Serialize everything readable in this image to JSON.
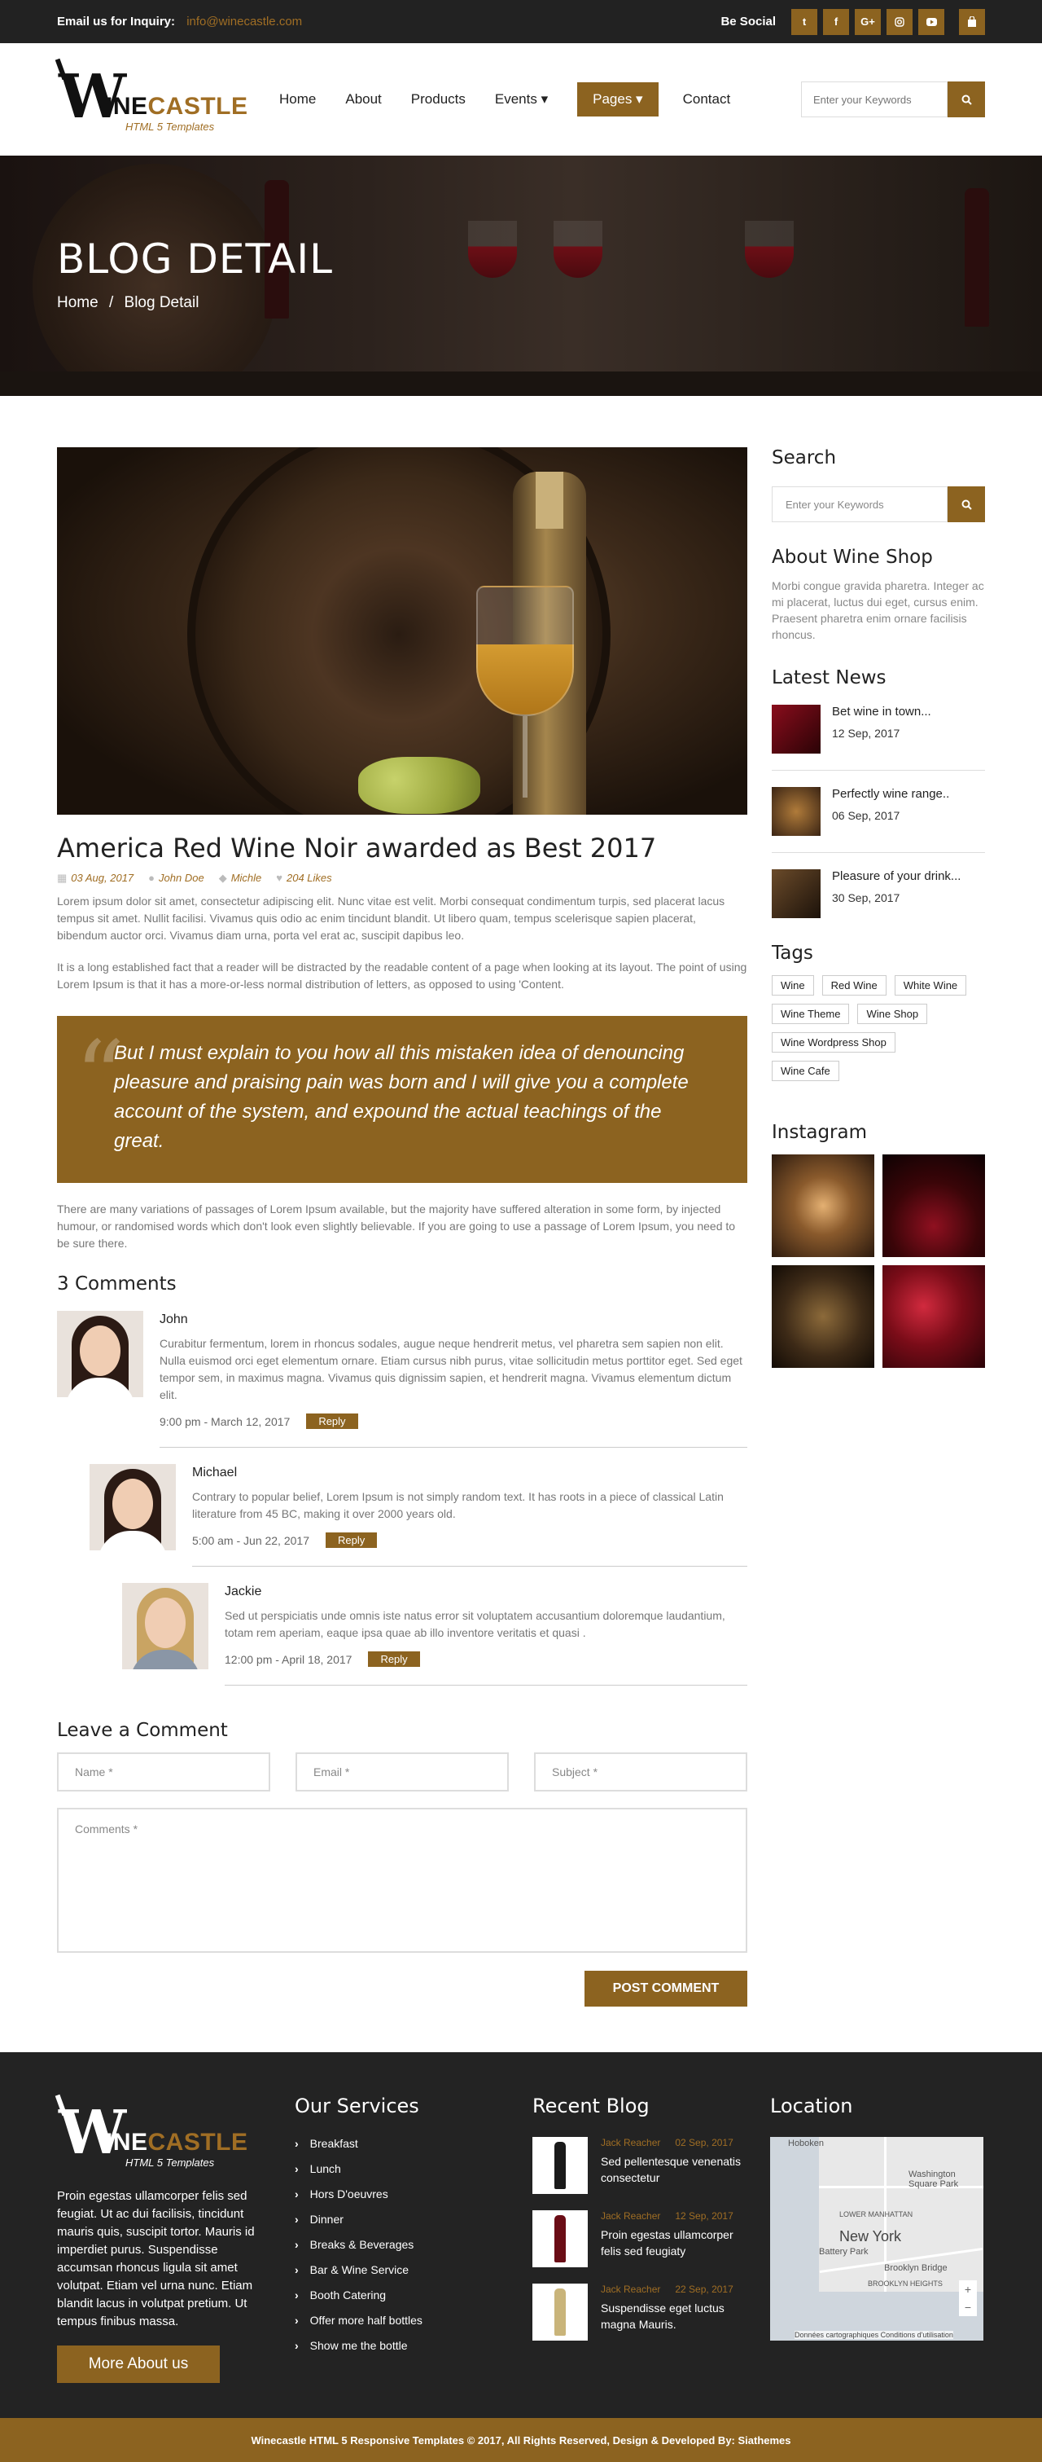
{
  "topbar": {
    "inquiry_label": "Email us for Inquiry:",
    "inquiry_email": "info@winecastle.com",
    "social_label": "Be Social",
    "social_icons": [
      "twitter-icon",
      "facebook-icon",
      "google-plus-icon",
      "instagram-icon",
      "youtube-icon",
      "shopping-bag-icon"
    ]
  },
  "logo": {
    "letter": "W",
    "name_dark": "INE",
    "name_brand": "CASTLE",
    "subtitle": "HTML 5 Templates"
  },
  "nav": {
    "items": [
      "Home",
      "About",
      "Products",
      "Events ▾",
      "Pages ▾",
      "Contact"
    ],
    "active": "Pages ▾",
    "search_placeholder": "Enter your Keywords"
  },
  "banner": {
    "title": "BLOG DETAIL",
    "breadcrumb_home": "Home",
    "breadcrumb_sep": "/",
    "breadcrumb_current": "Blog Detail"
  },
  "post": {
    "title": "America Red Wine Noir awarded as Best 2017",
    "date": "03 Aug, 2017",
    "author1": "John Doe",
    "author2": "Michle",
    "likes": "204 Likes",
    "para1": "Lorem ipsum dolor sit amet, consectetur adipiscing elit. Nunc vitae est velit. Morbi consequat condimentum turpis, sed placerat lacus tempus sit amet. Nullit facilisi. Vivamus quis odio ac enim tincidunt blandit. Ut libero quam, tempus scelerisque sapien placerat, bibendum auctor orci. Vivamus diam urna, porta vel erat ac, suscipit dapibus leo.",
    "para2": "It is a long established fact that a reader will be distracted by the readable content of a page when looking at its layout. The point of using Lorem Ipsum is that it has a more-or-less normal distribution of letters, as opposed to using 'Content.",
    "quote": "But I must explain to you how all this mistaken idea of denouncing pleasure and praising pain was born and I will give you a complete account of the system, and expound the actual teachings of the great.",
    "para3": "There are many variations of passages of Lorem Ipsum available, but the majority have suffered alteration in some form, by injected humour, or randomised words which don't look even slightly believable. If you are going to use a passage of Lorem Ipsum, you need to be sure there."
  },
  "comments": {
    "title": "3 Comments",
    "reply_label": "Reply",
    "items": [
      {
        "name": "John",
        "text": "Curabitur fermentum, lorem in rhoncus sodales, augue neque hendrerit metus, vel pharetra sem sapien non elit. Nulla euismod orci eget elementum ornare. Etiam cursus nibh purus, vitae sollicitudin metus porttitor eget. Sed eget tempor sem, in maximus magna. Vivamus quis dignissim sapien, et hendrerit magna. Vivamus elementum dictum elit.",
        "time": "9:00 pm - March 12, 2017"
      },
      {
        "name": "Michael",
        "text": "Contrary to popular belief, Lorem Ipsum is not simply random text. It has roots in a piece of classical Latin literature from 45 BC, making it over 2000 years old.",
        "time": "5:00 am - Jun 22, 2017"
      },
      {
        "name": "Jackie",
        "text": "Sed ut perspiciatis unde omnis iste natus error sit voluptatem accusantium doloremque laudantium, totam rem aperiam, eaque ipsa quae ab illo inventore veritatis et quasi .",
        "time": "12:00 pm - April 18, 2017"
      }
    ]
  },
  "form": {
    "title": "Leave a Comment",
    "name_placeholder": "Name *",
    "email_placeholder": "Email *",
    "subject_placeholder": "Subject *",
    "comments_placeholder": "Comments *",
    "submit_label": "POST COMMENT"
  },
  "sidebar": {
    "search_title": "Search",
    "search_placeholder": "Enter your Keywords",
    "about_title": "About Wine Shop",
    "about_text": "Morbi congue gravida pharetra. Integer ac mi placerat, luctus dui eget, cursus enim. Praesent pharetra enim ornare facilisis rhoncus.",
    "news_title": "Latest News",
    "news": [
      {
        "title": "Bet wine in town...",
        "date": "12 Sep, 2017"
      },
      {
        "title": "Perfectly wine range..",
        "date": "06 Sep, 2017"
      },
      {
        "title": "Pleasure of your drink...",
        "date": "30 Sep, 2017"
      }
    ],
    "tags_title": "Tags",
    "tags": [
      "Wine",
      "Red Wine",
      "White Wine",
      "Wine Theme",
      "Wine Shop",
      "Wine Wordpress Shop",
      "Wine Cafe"
    ],
    "instagram_title": "Instagram"
  },
  "footer": {
    "desc": "Proin egestas ullamcorper felis sed feugiat. Ut ac dui facilisis, tincidunt mauris quis, suscipit tortor. Mauris id imperdiet purus. Suspendisse accumsan rhoncus ligula sit amet volutpat. Etiam vel urna nunc. Etiam blandit lacus in volutpat pretium. Ut tempus finibus massa.",
    "more_label": "More About us",
    "services_title": "Our Services",
    "services": [
      "Breakfast",
      "Lunch",
      "Hors D'oeuvres",
      "Dinner",
      "Breaks & Beverages",
      "Bar & Wine Service",
      "Booth Catering",
      "Offer more half bottles",
      "Show me the bottle"
    ],
    "blog_title": "Recent Blog",
    "blog": [
      {
        "author": "Jack Reacher",
        "date": "02 Sep, 2017",
        "title": "Sed pellentesque venenatis consectetur"
      },
      {
        "author": "Jack Reacher",
        "date": "12 Sep, 2017",
        "title": "Proin egestas ullamcorper felis sed feugiaty"
      },
      {
        "author": "Jack Reacher",
        "date": "22 Sep, 2017",
        "title": "Suspendisse eget luctus magna Mauris."
      }
    ],
    "location_title": "Location",
    "map": {
      "city": "New York",
      "labels": [
        "Hoboken",
        "Washington Square Park",
        "LOWER MANHATTAN",
        "Battery Park",
        "Brooklyn Bridge",
        "BROOKLYN HEIGHTS"
      ],
      "attribution": "Données cartographiques   Conditions d'utilisation"
    },
    "copyright": "Winecastle HTML 5 Responsive Templates © 2017, All Rights Reserved, Design & Developed By: Siathemes"
  },
  "colors": {
    "brand": "#8c6320",
    "brand_text": "#a06e24",
    "dark": "#232323"
  }
}
